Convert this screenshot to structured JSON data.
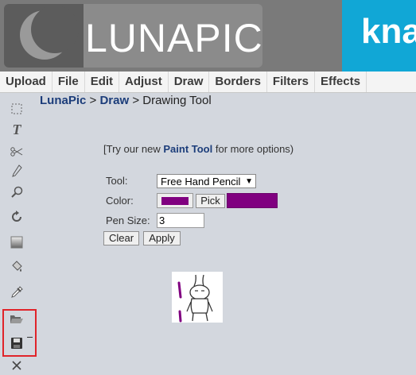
{
  "header": {
    "logo_text": "LUNAPIC",
    "ad_text": "kna"
  },
  "menu": [
    "Upload",
    "File",
    "Edit",
    "Adjust",
    "Draw",
    "Borders",
    "Filters",
    "Effects"
  ],
  "breadcrumb": {
    "home": "LunaPic",
    "sep1": " > ",
    "section": "Draw",
    "sep2": " > ",
    "page": "Drawing Tool"
  },
  "promo": {
    "prefix": "[Try our new ",
    "link": "Paint Tool",
    "suffix": " for more options)"
  },
  "form": {
    "tool_label": "Tool:",
    "tool_value": "Free Hand Pencil",
    "color_label": "Color:",
    "color_value": "#800080",
    "pick_label": "Pick",
    "pen_size_label": "Pen Size:",
    "pen_size_value": "3",
    "clear_label": "Clear",
    "apply_label": "Apply"
  },
  "toolbar_icons": [
    "select-icon",
    "text-icon",
    "scissors-icon",
    "pencil-icon",
    "magnify-icon",
    "rotate-icon",
    "gradient-icon",
    "paint-bucket-icon",
    "eyedropper-icon",
    "open-folder-icon",
    "save-icon",
    "close-icon"
  ],
  "colors": {
    "accent": "#800080",
    "link": "#1c3d7a",
    "ad": "#11a7d6",
    "highlight": "#e0242a"
  }
}
